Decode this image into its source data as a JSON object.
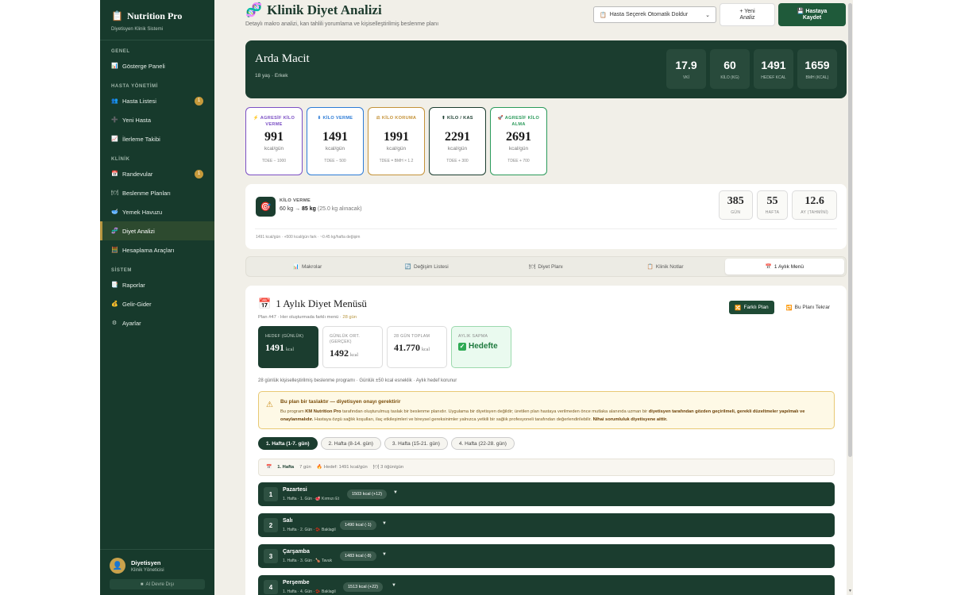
{
  "sidebar": {
    "brand": "Nutrition Pro",
    "subtitle": "Diyetisyen Klinik Sistemi",
    "groups": [
      {
        "label": "GENEL",
        "items": [
          {
            "label": "Gösterge Paneli",
            "icon": "chart-icon"
          }
        ]
      },
      {
        "label": "HASTA YÖNETİMİ",
        "items": [
          {
            "label": "Hasta Listesi",
            "icon": "people-icon",
            "badge": "1"
          },
          {
            "label": "Yeni Hasta",
            "icon": "plus-icon"
          },
          {
            "label": "İlerleme Takibi",
            "icon": "trend-icon"
          }
        ]
      },
      {
        "label": "KLİNİK",
        "items": [
          {
            "label": "Randevular",
            "icon": "calendar-icon",
            "badge": "1"
          },
          {
            "label": "Beslenme Planları",
            "icon": "plate-icon"
          },
          {
            "label": "Yemek Havuzu",
            "icon": "bowl-icon"
          },
          {
            "label": "Diyet Analizi",
            "icon": "dna-icon",
            "active": true
          },
          {
            "label": "Hesaplama Araçları",
            "icon": "calculator-icon"
          }
        ]
      },
      {
        "label": "SİSTEM",
        "items": [
          {
            "label": "Raporlar",
            "icon": "report-icon"
          },
          {
            "label": "Gelir-Gider",
            "icon": "money-icon"
          },
          {
            "label": "Ayarlar",
            "icon": "gear-icon"
          }
        ]
      }
    ],
    "user": {
      "name": "Diyetisyen",
      "role": "Klinik Yöneticisi",
      "ai_status": "AI Devre Dışı"
    }
  },
  "header": {
    "title": "Klinik Diyet Analizi",
    "subtitle": "Detaylı makro analizi, kan tahlili yorumlama ve kişiselleştirilmiş beslenme planı",
    "select_value": "Hasta Seçerek Otomatik Doldur",
    "new_label_1": "+ Yeni",
    "new_label_2": "Analiz",
    "save_label_1": "Hastaya",
    "save_label_2": "Kaydet"
  },
  "patient": {
    "name": "Arda Macit",
    "info": "18 yaş · Erkek",
    "stats": [
      {
        "value": "17.9",
        "label": "VKİ"
      },
      {
        "value": "60",
        "label": "KİLO (KG)"
      },
      {
        "value": "1491",
        "label": "HEDEF KCAL"
      },
      {
        "value": "1659",
        "label": "BMH (KCAL)"
      }
    ]
  },
  "goals": [
    {
      "label": "AGRESİF KİLO VERME",
      "value": "991",
      "unit": "kcal/gün",
      "formula": "TDEE − 1000",
      "color": "#7b4fc4",
      "icon": "⚡"
    },
    {
      "label": "KİLO VERME",
      "value": "1491",
      "unit": "kcal/gün",
      "formula": "TDEE − 500",
      "color": "#2c7bd6",
      "icon": "⬇"
    },
    {
      "label": "KİLO KORUMA",
      "value": "1991",
      "unit": "kcal/gün",
      "formula": "TDEE = BMH × 1.2",
      "color": "#c49238",
      "icon": "⚖"
    },
    {
      "label": "KİLO / KAS",
      "value": "2291",
      "unit": "kcal/gün",
      "formula": "TDEE + 300",
      "color": "#1b3d2f",
      "icon": "⬆"
    },
    {
      "label": "AGRESİF KİLO ALMA",
      "value": "2691",
      "unit": "kcal/gün",
      "formula": "TDEE + 700",
      "color": "#2a9a5a",
      "icon": "🚀"
    }
  ],
  "target": {
    "label": "KİLO VERME",
    "from": "60 kg →",
    "to": "85 kg",
    "note": "(25.0 kg alınacak)",
    "stats": [
      {
        "value": "385",
        "label": "GÜN"
      },
      {
        "value": "55",
        "label": "HAFTA"
      },
      {
        "value": "12.6",
        "label": "AY (TAHMİNİ)"
      }
    ],
    "footer": "1491 kcal/gün · +500 kcal/gün fark · ~0.45 kg/hafta değişim"
  },
  "tabs": [
    {
      "label": "Makrolar",
      "icon": "chart-icon"
    },
    {
      "label": "Değişim Listesi",
      "icon": "swap-icon"
    },
    {
      "label": "Diyet Planı",
      "icon": "plate-icon"
    },
    {
      "label": "Klinik Notlar",
      "icon": "note-icon"
    },
    {
      "label": "1 Aylık Menü",
      "icon": "calendar-icon",
      "active": true
    }
  ],
  "menu": {
    "title": "1 Aylık Diyet Menüsü",
    "plan_info": "Plan #47 · Her oluşturmada farklı menü ·",
    "days_highlight": "28 gün",
    "btn_diff": "Farklı Plan",
    "btn_repeat": "Bu Planı Tekrar",
    "kcal": [
      {
        "label": "HEDEF (GÜNLÜK)",
        "value": "1491",
        "unit": "kcal"
      },
      {
        "label": "GÜNLÜK ORT. (GERÇEK)",
        "value": "1492",
        "unit": "kcal"
      },
      {
        "label": "28 GÜN TOPLAM",
        "value": "41.770",
        "unit": "kcal"
      },
      {
        "label": "AYLIK SAPMA",
        "value": "Hedefte"
      }
    ],
    "description": "28 günlük kişiselleştirilmiş beslenme programı · Günlük ±50 kcal esneklik · Aylık hedef korunur",
    "warning_title": "Bu plan bir taslaktır — diyetisyen onayı gerektirir",
    "warning_p1": "Bu program ",
    "warning_brand": "KM Nutrition Pro",
    "warning_p2": " tarafından oluşturulmuş taslak bir beslenme planıdır. Uygulama bir diyetisyen değildir; üretilen plan hastaya verilmeden önce mutlaka alanında uzman bir ",
    "warning_b1": "diyetisyen tarafından gözden geçirilmeli, gerekli düzeltmeler yapılmalı ve onaylanmalıdır.",
    "warning_p3": " Hastaya özgü sağlık koşulları, ilaç etkileşimleri ve bireysel gereksinimler yalnızca yetkili bir sağlık profesyoneli tarafından değerlendirilebilir. ",
    "warning_b2": "Nihai sorumluluk diyetisyene aittir.",
    "weeks": [
      "1. Hafta (1-7. gün)",
      "2. Hafta (8-14. gün)",
      "3. Hafta (15-21. gün)",
      "4. Hafta (22-28. gün)"
    ],
    "week_info": {
      "title": "1. Hafta",
      "days": "7 gün",
      "target": "Hedef: 1491 kcal/gün",
      "meals": "3 öğün/gün"
    },
    "days": [
      {
        "num": "1",
        "name": "Pazartesi",
        "sub": "1. Hafta · 1. Gün ·",
        "tag": "Kırmızı Et",
        "tag_icon": "🥩",
        "kcal": "1503 kcal (+12)"
      },
      {
        "num": "2",
        "name": "Salı",
        "sub": "1. Hafta · 2. Gün ·",
        "tag": "Baklagil",
        "tag_icon": "🫘",
        "kcal": "1490 kcal (-1)"
      },
      {
        "num": "3",
        "name": "Çarşamba",
        "sub": "1. Hafta · 3. Gün ·",
        "tag": "Tavuk",
        "tag_icon": "🍗",
        "kcal": "1483 kcal (-8)"
      },
      {
        "num": "4",
        "name": "Perşembe",
        "sub": "1. Hafta · 4. Gün ·",
        "tag": "Baklagil",
        "tag_icon": "🫘",
        "kcal": "1513 kcal (+22)"
      }
    ]
  }
}
